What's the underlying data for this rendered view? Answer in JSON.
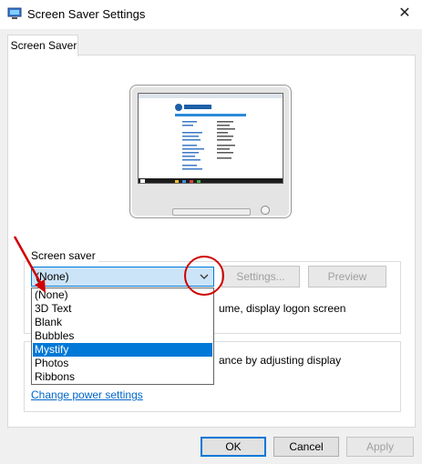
{
  "window": {
    "title": "Screen Saver Settings",
    "close_glyph": "✕"
  },
  "tab": {
    "label": "Screen Saver"
  },
  "screen_saver": {
    "group_label": "Screen saver",
    "selected_value": "(None)",
    "options": [
      "(None)",
      "3D Text",
      "Blank",
      "Bubbles",
      "Mystify",
      "Photos",
      "Ribbons"
    ],
    "highlighted_option": "Mystify",
    "settings_label": "Settings...",
    "preview_label": "Preview",
    "logon_text": "ume, display logon screen"
  },
  "power": {
    "text": "ance by adjusting display",
    "link": "Change power settings"
  },
  "buttons": {
    "ok": "OK",
    "cancel": "Cancel",
    "apply": "Apply"
  },
  "colors": {
    "accent": "#0078d7",
    "selection": "#0078d7",
    "combo_bg": "#cce4f7",
    "link": "#0066cc",
    "annotation": "#d00000"
  },
  "icons": [
    "app-icon",
    "close-icon",
    "chevron-down-icon"
  ]
}
